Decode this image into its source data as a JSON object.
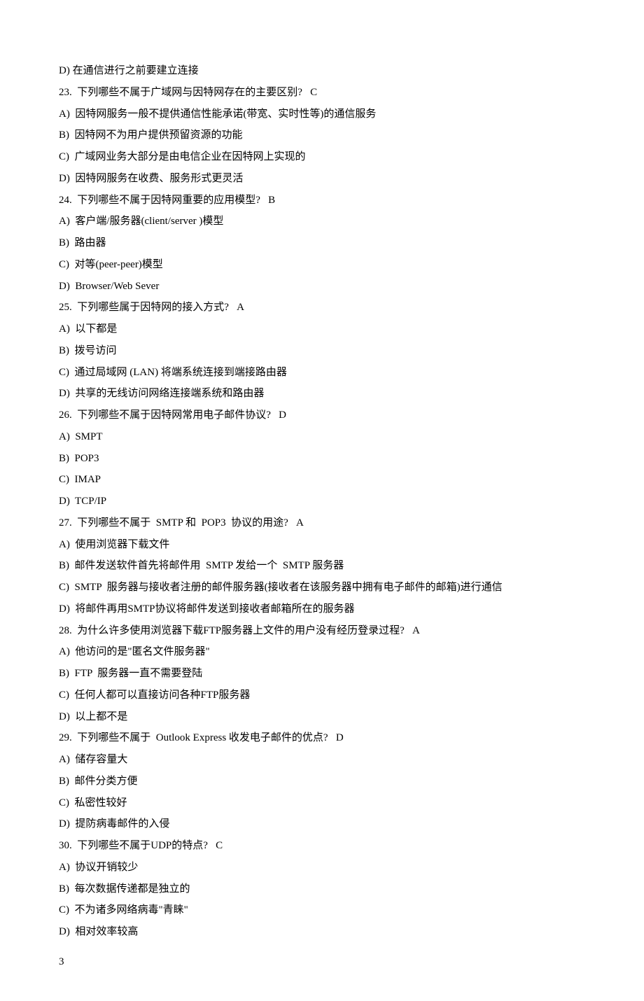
{
  "lines": [
    "D) 在通信进行之前要建立连接",
    "23.  下列哪些不属于广域网与因特网存在的主要区别?   C",
    "A)  因特网服务一般不提供通信性能承诺(带宽、实时性等)的通信服务",
    "B)  因特网不为用户提供预留资源的功能",
    "C)  广域网业务大部分是由电信企业在因特网上实现的",
    "D)  因特网服务在收费、服务形式更灵活",
    "24.  下列哪些不属于因特网重要的应用模型?   B",
    "A)  客户端/服务器(client/server )模型",
    "B)  路由器",
    "C)  对等(peer-peer)模型",
    "D)  Browser/Web Sever",
    "25.  下列哪些属于因特网的接入方式?   A",
    "A)  以下都是",
    "B)  拨号访问",
    "C)  通过局域网 (LAN) 将端系统连接到端接路由器",
    "D)  共享的无线访问网络连接端系统和路由器",
    "26.  下列哪些不属于因特网常用电子邮件协议?   D",
    "A)  SMPT",
    "B)  POP3",
    "C)  IMAP",
    "D)  TCP/IP",
    "27.  下列哪些不属于  SMTP 和  POP3  协议的用途?   A",
    "A)  使用浏览器下载文件",
    "B)  邮件发送软件首先将邮件用  SMTP 发给一个  SMTP 服务器",
    "C)  SMTP  服务器与接收者注册的邮件服务器(接收者在该服务器中拥有电子邮件的邮箱)进行通信",
    "D)  将邮件再用SMTP协议将邮件发送到接收者邮箱所在的服务器",
    "28.  为什么许多使用浏览器下载FTP服务器上文件的用户没有经历登录过程?   A",
    "A)  他访问的是\"匿名文件服务器\"",
    "B)  FTP  服务器一直不需要登陆",
    "C)  任何人都可以直接访问各种FTP服务器",
    "D)  以上都不是",
    "29.  下列哪些不属于  Outlook Express 收发电子邮件的优点?   D",
    "A)  储存容量大",
    "B)  邮件分类方便",
    "C)  私密性较好",
    "D)  提防病毒邮件的入侵",
    "30.  下列哪些不属于UDP的特点?   C",
    "A)  协议开销较少",
    "B)  每次数据传递都是独立的",
    "C)  不为诸多网络病毒\"青睐\"",
    "D)  相对效率较高"
  ],
  "page_number": "3"
}
